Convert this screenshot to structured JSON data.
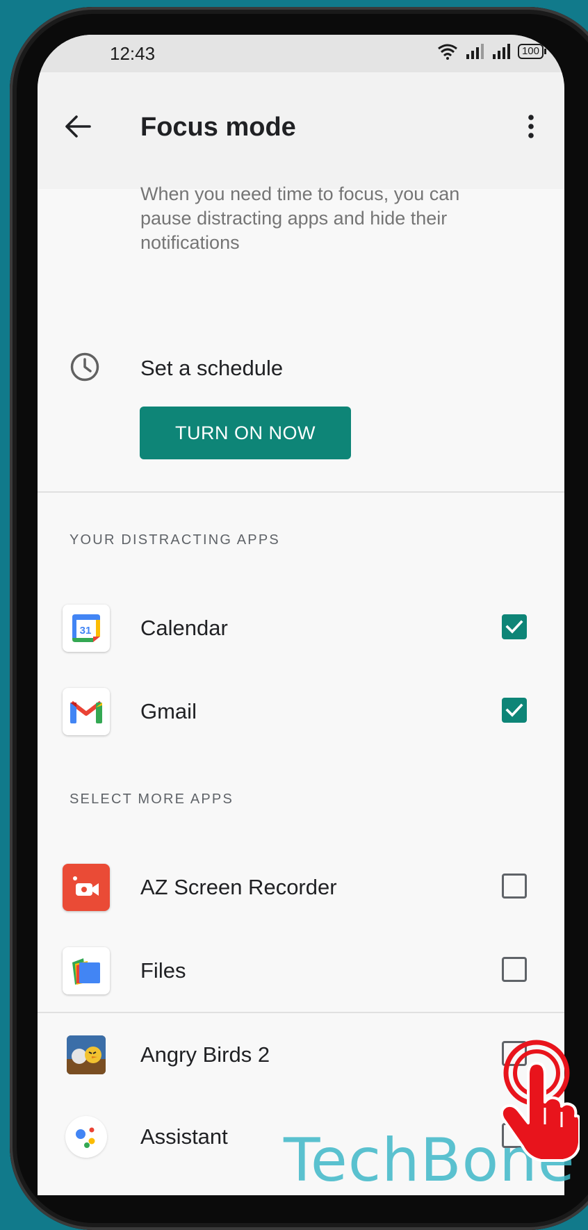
{
  "status_bar": {
    "time": "12:43",
    "battery": "100",
    "icons": [
      "wifi-icon",
      "signal-icon",
      "signal-icon",
      "battery-icon"
    ]
  },
  "app_bar": {
    "title": "Focus mode",
    "back_icon": "arrow-back-icon",
    "menu_icon": "more-vert-icon"
  },
  "description": "When you need time to focus, you can pause distracting apps and hide their notifications",
  "schedule": {
    "icon": "clock-icon",
    "label": "Set a schedule"
  },
  "turn_on_button": "TURN ON NOW",
  "sections": {
    "distracting": {
      "header": "YOUR DISTRACTING APPS",
      "apps": [
        {
          "name": "Calendar",
          "icon": "calendar-app-icon",
          "icon_text": "31",
          "checked": true
        },
        {
          "name": "Gmail",
          "icon": "gmail-app-icon",
          "checked": true
        }
      ]
    },
    "more": {
      "header": "SELECT MORE APPS",
      "apps": [
        {
          "name": "AZ Screen Recorder",
          "icon": "screen-recorder-app-icon",
          "checked": false
        },
        {
          "name": "Files",
          "icon": "files-app-icon",
          "checked": false
        },
        {
          "name": "Angry Birds 2",
          "icon": "angry-birds-app-icon",
          "checked": false
        },
        {
          "name": "Assistant",
          "icon": "assistant-app-icon",
          "checked": false
        }
      ]
    }
  },
  "watermark": "TechBone",
  "colors": {
    "accent": "#0e8577",
    "background": "#117a8b",
    "tap_indicator": "#e8141c"
  }
}
